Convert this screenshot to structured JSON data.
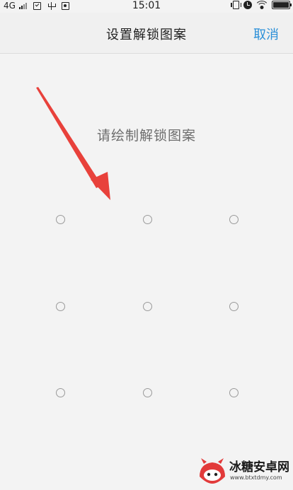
{
  "status_bar": {
    "network": "4G",
    "time": "15:01"
  },
  "header": {
    "title": "设置解锁图案",
    "cancel_label": "取消"
  },
  "main": {
    "prompt": "请绘制解锁图案"
  },
  "colors": {
    "accent": "#2a8fd8",
    "annotation_arrow": "#e8413b",
    "background": "#f3f3f3"
  },
  "watermark": {
    "title": "冰糖安卓网",
    "url": "www.btxtdmy.com"
  }
}
